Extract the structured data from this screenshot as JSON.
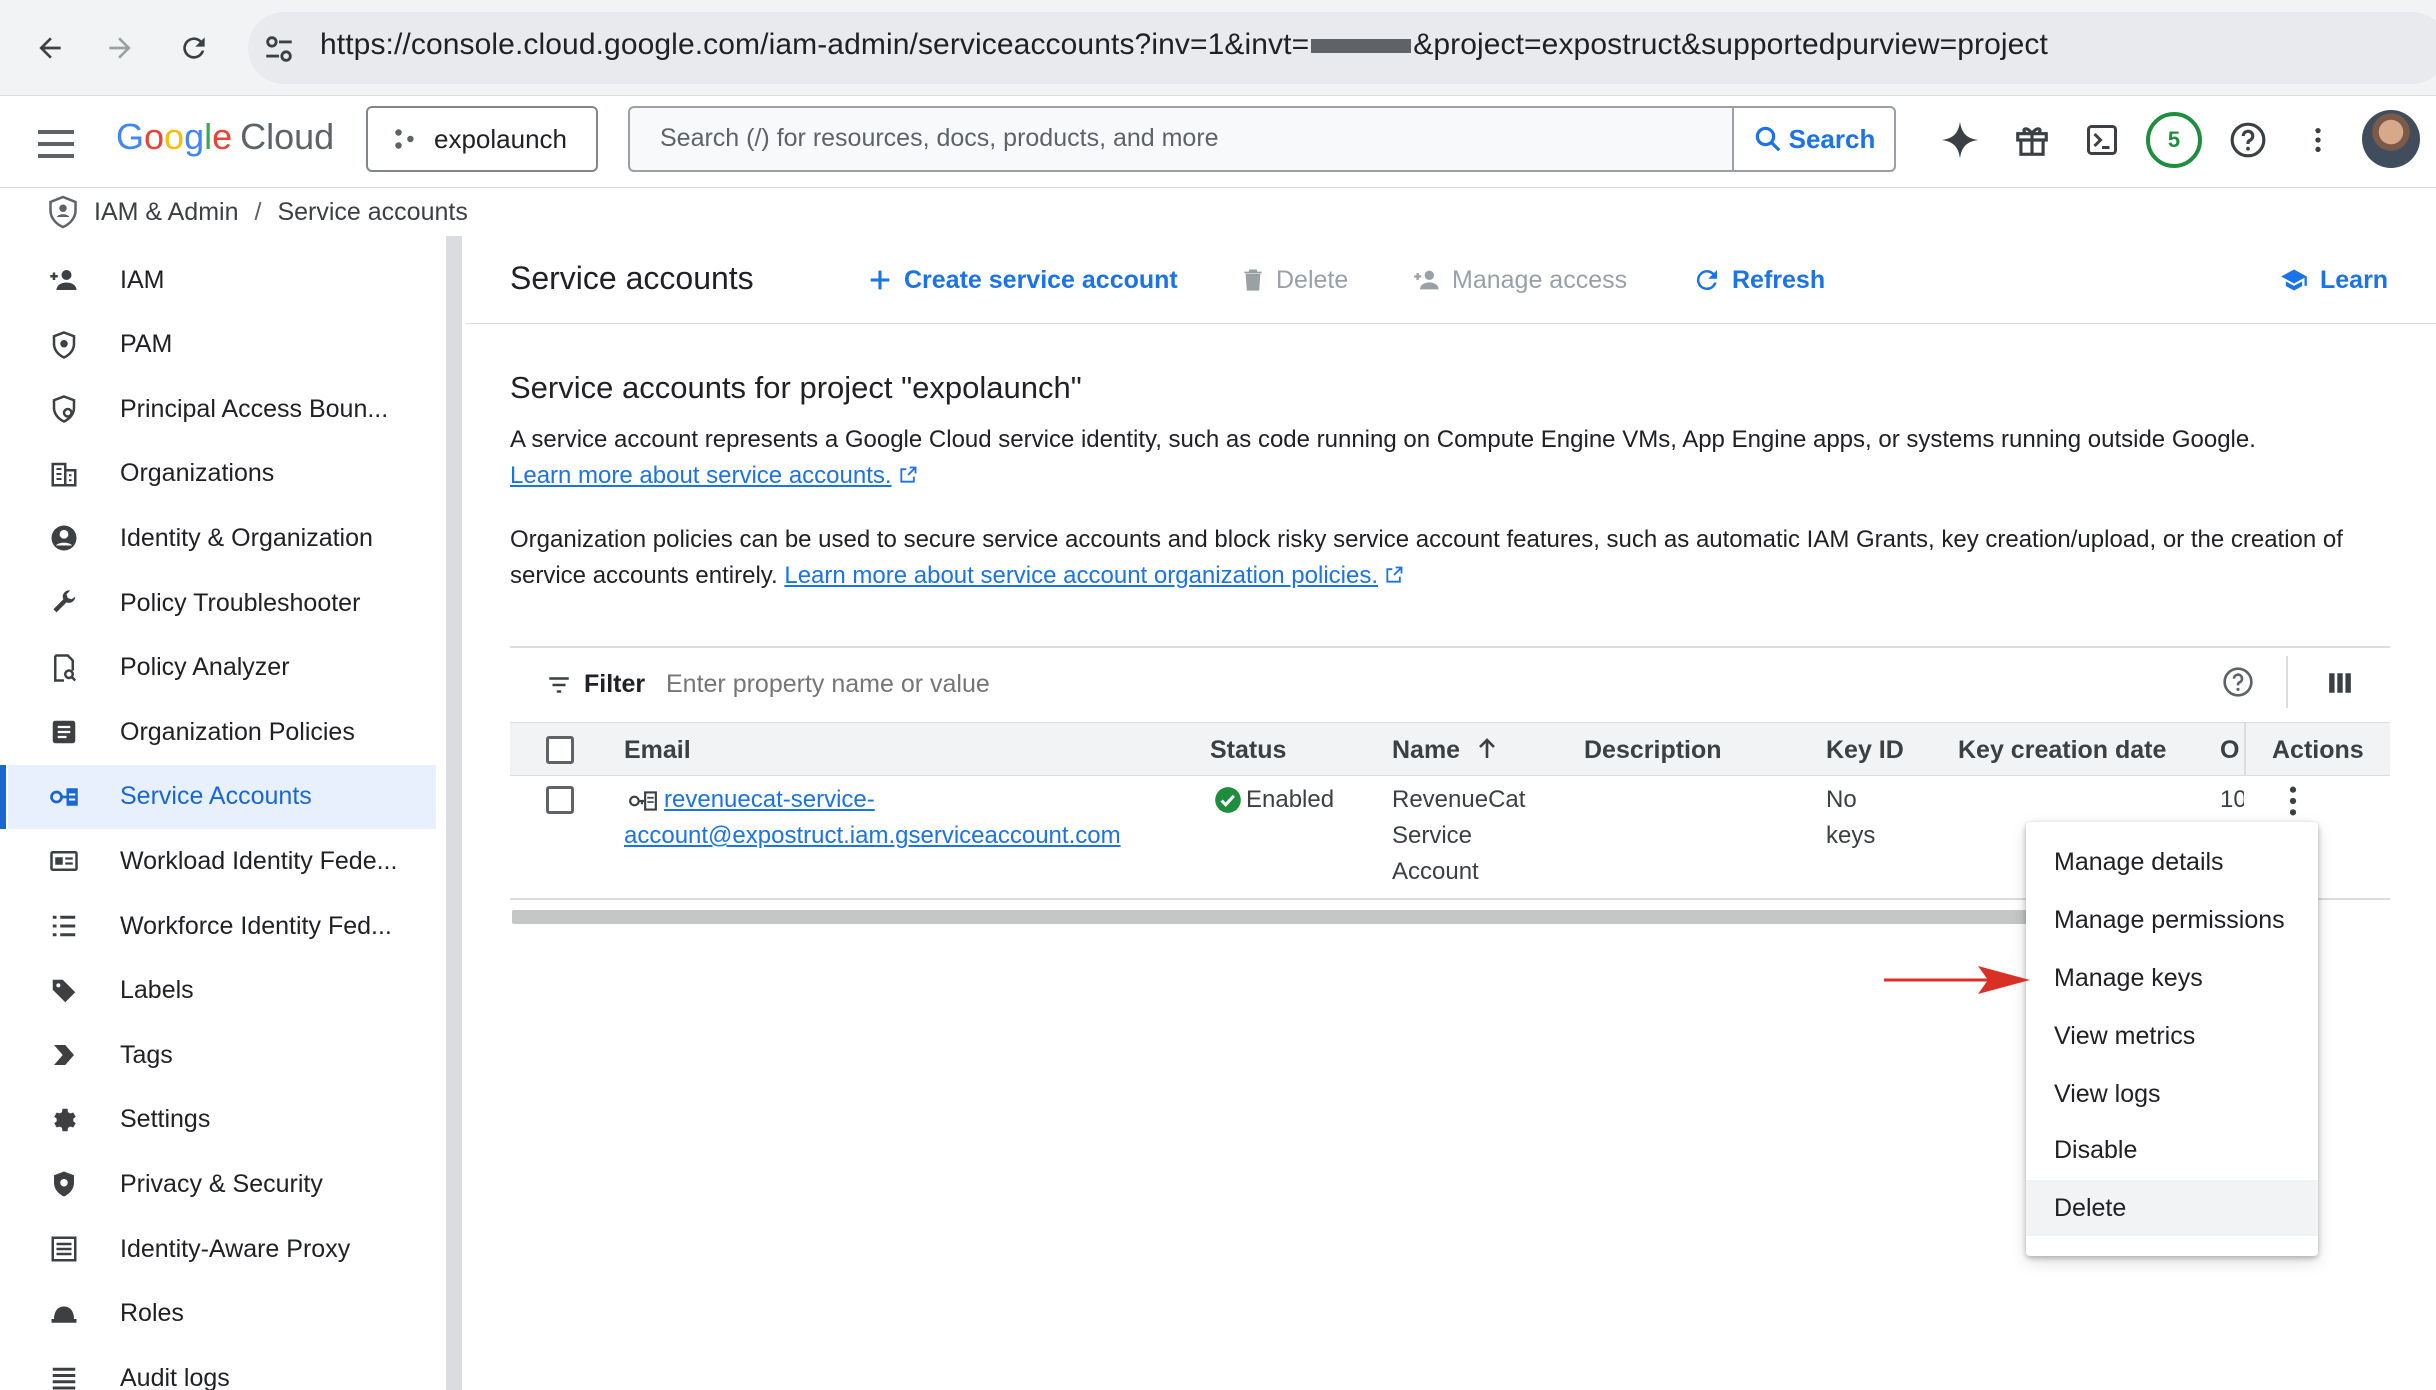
{
  "browser": {
    "url_prefix": "https://console.cloud.google.com/iam-admin/serviceaccounts?inv=1&invt=",
    "url_suffix": "&project=expostruct&supportedpurview=project"
  },
  "header": {
    "logo_google": [
      "G",
      "o",
      "o",
      "g",
      "l",
      "e"
    ],
    "logo_cloud": "Cloud",
    "project": "expolaunch",
    "search_placeholder": "Search (/) for resources, docs, products, and more",
    "search_button": "Search",
    "notification_count": "5"
  },
  "breadcrumb": {
    "section": "IAM & Admin",
    "separator": "/",
    "page": "Service accounts"
  },
  "sidebar": {
    "items": [
      {
        "label": "IAM",
        "icon": "person-add-icon"
      },
      {
        "label": "PAM",
        "icon": "shield-icon"
      },
      {
        "label": "Principal Access Boun...",
        "icon": "policy-icon"
      },
      {
        "label": "Organizations",
        "icon": "building-icon"
      },
      {
        "label": "Identity & Organization",
        "icon": "account-circle-icon"
      },
      {
        "label": "Policy Troubleshooter",
        "icon": "wrench-icon"
      },
      {
        "label": "Policy Analyzer",
        "icon": "document-search-icon"
      },
      {
        "label": "Organization Policies",
        "icon": "list-box-icon"
      },
      {
        "label": "Service Accounts",
        "icon": "service-account-icon",
        "active": true
      },
      {
        "label": "Workload Identity Fede...",
        "icon": "id-card-icon"
      },
      {
        "label": "Workforce Identity Fed...",
        "icon": "list-icon"
      },
      {
        "label": "Labels",
        "icon": "tag-icon"
      },
      {
        "label": "Tags",
        "icon": "chevron-tag-icon"
      },
      {
        "label": "Settings",
        "icon": "gear-icon"
      },
      {
        "label": "Privacy & Security",
        "icon": "shield-check-icon"
      },
      {
        "label": "Identity-Aware Proxy",
        "icon": "proxy-icon"
      },
      {
        "label": "Roles",
        "icon": "hat-icon"
      },
      {
        "label": "Audit logs",
        "icon": "lines-icon"
      }
    ]
  },
  "toolbar": {
    "title": "Service accounts",
    "create": "Create service account",
    "delete": "Delete",
    "manage_access": "Manage access",
    "refresh": "Refresh",
    "learn": "Learn"
  },
  "content": {
    "section_title": "Service accounts for project \"expolaunch\"",
    "para1": "A service account represents a Google Cloud service identity, such as code running on Compute Engine VMs, App Engine apps, or systems running outside Google.",
    "para1_link": "Learn more about service accounts.",
    "para2": "Organization policies can be used to secure service accounts and block risky service account features, such as automatic IAM Grants, key creation/upload, or the creation of service accounts entirely.",
    "para2_link": "Learn more about service account organization policies."
  },
  "table": {
    "filter_label": "Filter",
    "filter_placeholder": "Enter property name or value",
    "columns": {
      "email": "Email",
      "status": "Status",
      "name": "Name",
      "description": "Description",
      "key_id": "Key ID",
      "key_creation_date": "Key creation date",
      "oauth_truncated": "O",
      "actions": "Actions"
    },
    "rows": [
      {
        "email_line1": "revenuecat-service-",
        "email_line2": "account@expostruct.iam.gserviceaccount.com",
        "status": "Enabled",
        "name_lines": [
          "RevenueCat",
          "Service",
          "Account"
        ],
        "description": "",
        "key_id_lines": [
          "No",
          "keys"
        ],
        "key_creation_date": "",
        "oauth_truncated": "10"
      }
    ]
  },
  "menu": {
    "items": [
      "Manage details",
      "Manage permissions",
      "Manage keys",
      "View metrics",
      "View logs",
      "Disable",
      "Delete"
    ]
  },
  "colors": {
    "accent": "#1a73e8",
    "active_bg": "#e8f0fe",
    "status_green": "#1e8e3e",
    "annotation_arrow": "#d93025"
  }
}
